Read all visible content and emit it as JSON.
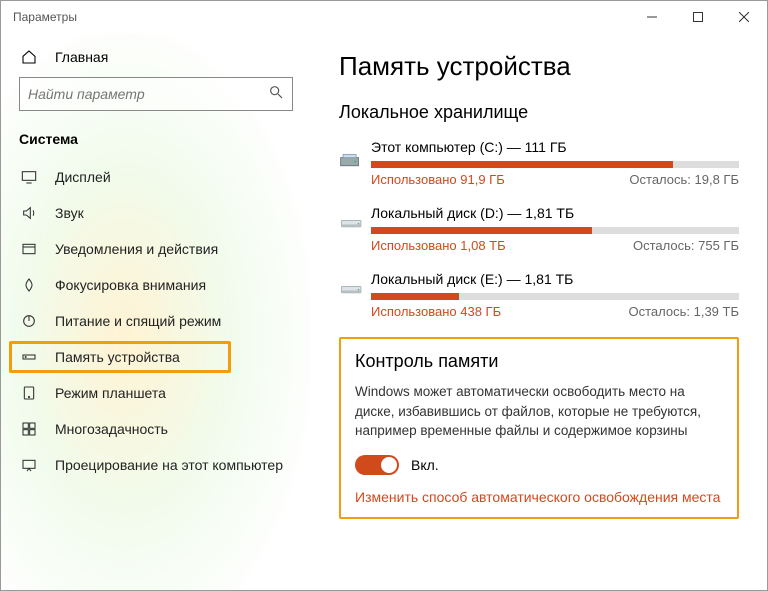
{
  "window": {
    "title": "Параметры"
  },
  "sidebar": {
    "home": "Главная",
    "search_placeholder": "Найти параметр",
    "category": "Система",
    "items": [
      {
        "label": "Дисплей"
      },
      {
        "label": "Звук"
      },
      {
        "label": "Уведомления и действия"
      },
      {
        "label": "Фокусировка внимания"
      },
      {
        "label": "Питание и спящий режим"
      },
      {
        "label": "Память устройства"
      },
      {
        "label": "Режим планшета"
      },
      {
        "label": "Многозадачность"
      },
      {
        "label": "Проецирование на этот компьютер"
      }
    ]
  },
  "main": {
    "title": "Память устройства",
    "local_storage": "Локальное хранилище",
    "disks": [
      {
        "name": "Этот компьютер (C:) — 111 ГБ",
        "used": "Использовано 91,9 ГБ",
        "free": "Осталось: 19,8 ГБ",
        "pct": 82
      },
      {
        "name": "Локальный диск (D:) — 1,81 ТБ",
        "used": "Использовано 1,08 ТБ",
        "free": "Осталось: 755 ГБ",
        "pct": 60
      },
      {
        "name": "Локальный диск (E:) — 1,81 ТБ",
        "used": "Использовано 438 ГБ",
        "free": "Осталось: 1,39 ТБ",
        "pct": 24
      }
    ],
    "sense": {
      "title": "Контроль памяти",
      "desc": "Windows может автоматически освободить место на диске, избавившись от файлов, которые не требуются, например временные файлы и содержимое корзины",
      "toggle_label": "Вкл.",
      "toggle_on": true,
      "link": "Изменить способ автоматического освобождения места"
    }
  }
}
